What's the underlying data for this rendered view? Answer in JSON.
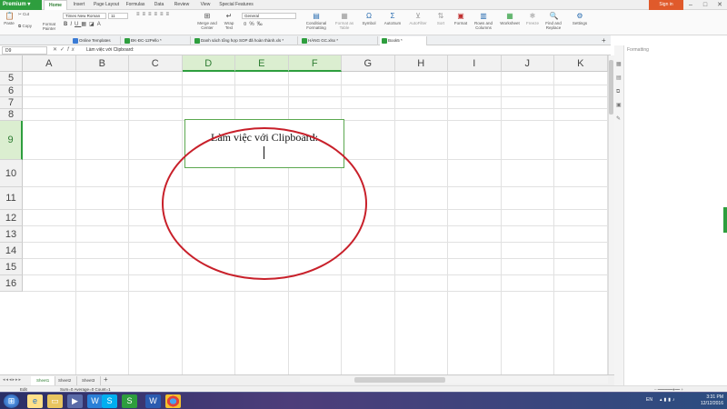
{
  "app": {
    "brand": "Premium",
    "signin": "Sign in"
  },
  "menu": [
    "Home",
    "Insert",
    "Page Layout",
    "Formulas",
    "Data",
    "Review",
    "View",
    "Special Features"
  ],
  "menu_active": 0,
  "ribbon": {
    "cut": "Cut",
    "copy": "Copy",
    "paste": "Paste",
    "format_painter": "Format Painter",
    "font_name": "Times New Roman",
    "font_size": "11",
    "merge_center": "Merge and Center",
    "wrap_text": "Wrap Text",
    "number_format": "General",
    "conditional_formatting": "Conditional Formatting",
    "format_as_table": "Format as Table",
    "symbol": "Symbol",
    "autosum": "AutoSum",
    "autofilter": "AutoFilter",
    "sort": "Sort",
    "format": "Format",
    "rows_columns": "Rows and Columns",
    "worksheet": "Worksheet",
    "freeze": "Freeze",
    "find_replace": "Find and Replace",
    "settings": "Settings"
  },
  "doc_tabs": [
    {
      "label": "Online Templates",
      "color": "#3a7bd5"
    },
    {
      "label": "ĐK-ĐC-12Pello *",
      "color": "#2e9e3e"
    },
    {
      "label": "Danh sách tổng hợp SOP đã hoàn thành.xls *",
      "color": "#2e9e3e"
    },
    {
      "label": "HÀNG GC.xlsx *",
      "color": "#2e9e3e"
    },
    {
      "label": "Book5 *",
      "color": "#2e9e3e"
    }
  ],
  "doc_tab_active": 4,
  "formula_bar": {
    "name_box": "D9",
    "content": "Làm việc với Clipboard:"
  },
  "columns": [
    "A",
    "B",
    "C",
    "D",
    "E",
    "F",
    "G",
    "H",
    "I",
    "J",
    "K"
  ],
  "selected_columns": [
    "D",
    "E",
    "F"
  ],
  "rows": [
    "5",
    "6",
    "7",
    "8",
    "9",
    "10",
    "11",
    "12",
    "13",
    "14",
    "15",
    "16"
  ],
  "selected_row": "9",
  "cell": {
    "text": "Làm việc với Clipboard:"
  },
  "sheets": [
    "Sheet1",
    "Sheet2",
    "Sheet3"
  ],
  "sheet_active": 0,
  "status": {
    "mode": "Edit",
    "stats": "Sum=0   Average=0   Count=1"
  },
  "pane": {
    "title": "Formatting"
  },
  "taskbar": {
    "lang": "EN",
    "time": "3:31 PM",
    "date": "12/12/2016"
  },
  "colors": {
    "accent": "#2e9e3e",
    "annotation": "#c8202a",
    "signin": "#e05a2b"
  }
}
